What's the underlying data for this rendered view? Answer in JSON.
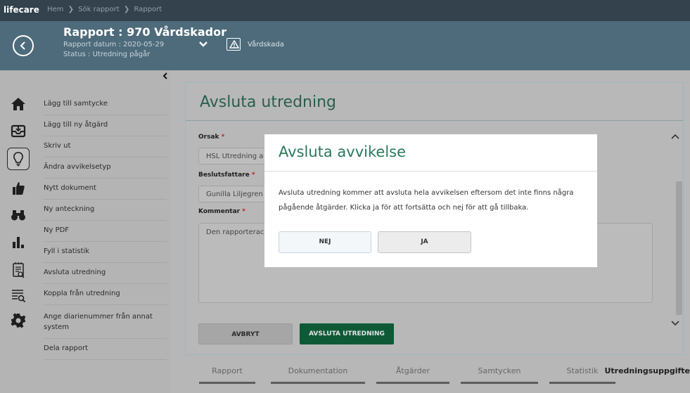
{
  "app": {
    "logo": "lifecare"
  },
  "breadcrumb": [
    {
      "label": "Hem"
    },
    {
      "label": "Sök rapport"
    },
    {
      "label": "Rapport"
    }
  ],
  "header": {
    "title": "Rapport : 970 Vårdskador",
    "date": "Rapport datum : 2020-05-29",
    "status": "Status : Utredning pågår",
    "category": "Vårdskada"
  },
  "rail_icons": [
    "home-icon",
    "inbox-icon",
    "lightbulb-icon",
    "thumbs-up-icon",
    "binoculars-icon",
    "bar-chart-icon",
    "checklist-icon",
    "list-search-icon",
    "gear-icon"
  ],
  "menu": {
    "items": [
      "Lägg till samtycke",
      "Lägg till ny åtgärd",
      "Skriv ut",
      "Ändra avvikelsetyp",
      "Nytt dokument",
      "Ny anteckning",
      "Ny PDF",
      "Fyll i statistik",
      "Avsluta utredning",
      "Koppla från utredning",
      "Ange diarienummer från annat system",
      "Dela rapport"
    ]
  },
  "form": {
    "title": "Avsluta utredning",
    "reason_label": "Orsak",
    "reason_value": "HSL Utredning a",
    "decision_maker_label": "Beslutsfattare",
    "decision_maker_value": "Gunilla Liljegren",
    "comment_label": "Kommentar",
    "comment_value": "Den rapporterac",
    "required_mark": "*",
    "cancel_label": "AVBRYT",
    "finish_label": "AVSLUTA UTREDNING"
  },
  "tabs": [
    {
      "label": "Rapport"
    },
    {
      "label": "Dokumentation"
    },
    {
      "label": "Åtgärder"
    },
    {
      "label": "Samtycken"
    },
    {
      "label": "Statistik"
    },
    {
      "label": "Utredningsuppgifte",
      "active": true
    }
  ],
  "modal": {
    "title": "Avsluta avvikelse",
    "body_line1": "Avsluta utredning kommer att avsluta hela avvikelsen eftersom det inte finns några",
    "body_line2": "pågående åtgärder. Klicka ja för att fortsätta och nej för att gå tillbaka.",
    "no_label": "NEJ",
    "yes_label": "JA"
  },
  "colors": {
    "header_bg": "#4e6b7b",
    "topbar_bg": "#33424d",
    "accent_green": "#0e5a36",
    "active_tab": "#1f7fae"
  }
}
